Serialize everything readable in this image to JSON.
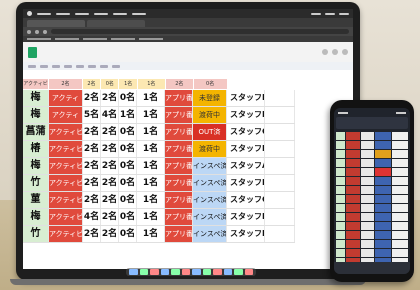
{
  "spreadsheet": {
    "header_labels": [
      "アクティビ",
      "2名",
      "2名",
      "0名",
      "1名",
      "1名",
      "2名",
      "0名",
      "",
      ""
    ],
    "rows": [
      {
        "name": "梅",
        "activity": "アクティ",
        "m1": "2名",
        "m2": "2名",
        "m3": "0名",
        "m4": "1名",
        "note": "アプリ番号",
        "status": "未登録",
        "staff": "スタッフE",
        "status_class": ""
      },
      {
        "name": "梅",
        "activity": "アクティ",
        "m1": "5名",
        "m2": "4名",
        "m3": "1名",
        "m4": "1名",
        "note": "アプリ番号",
        "status": "渡荷中",
        "staff": "スタッフB",
        "status_class": ""
      },
      {
        "name": "菖蒲",
        "activity": "アクティビ",
        "m1": "2名",
        "m2": "2名",
        "m3": "0名",
        "m4": "1名",
        "note": "アプリ番号",
        "status": "OUT済",
        "staff": "スタッフC",
        "status_class": "s-red"
      },
      {
        "name": "椿",
        "activity": "アクティビ",
        "m1": "2名",
        "m2": "2名",
        "m3": "0名",
        "m4": "1名",
        "note": "アプリ番号",
        "status": "渡荷中",
        "staff": "スタッフD",
        "status_class": ""
      },
      {
        "name": "梅",
        "activity": "アクティビ",
        "m1": "2名",
        "m2": "2名",
        "m3": "0名",
        "m4": "1名",
        "note": "アプリ番号",
        "status": "インスペ済",
        "staff": "スタッフA",
        "status_class": "s-blue"
      },
      {
        "name": "竹",
        "activity": "アクティビ",
        "m1": "2名",
        "m2": "2名",
        "m3": "0名",
        "m4": "1名",
        "note": "アプリ番号",
        "status": "インスペ済",
        "staff": "スタッフB",
        "status_class": "s-blue"
      },
      {
        "name": "菫",
        "activity": "アクティビ",
        "m1": "2名",
        "m2": "2名",
        "m3": "0名",
        "m4": "1名",
        "note": "アプリ番号",
        "status": "インスペ済",
        "staff": "スタッフC",
        "status_class": "s-blue"
      },
      {
        "name": "梅",
        "activity": "アクティビ",
        "m1": "4名",
        "m2": "2名",
        "m3": "0名",
        "m4": "1名",
        "note": "アプリ番号",
        "status": "インスペ済",
        "staff": "スタッフD",
        "status_class": "s-blue"
      },
      {
        "name": "竹",
        "activity": "アクティビ",
        "m1": "2名",
        "m2": "2名",
        "m3": "0名",
        "m4": "1名",
        "note": "アプリ番号",
        "status": "インスペ済",
        "staff": "スタッフE",
        "status_class": "s-blue"
      }
    ]
  },
  "phone": {
    "row_colors": [
      "",
      "",
      "orange",
      "",
      "red",
      "",
      "",
      "",
      "",
      "",
      "",
      "",
      "",
      "",
      ""
    ]
  }
}
